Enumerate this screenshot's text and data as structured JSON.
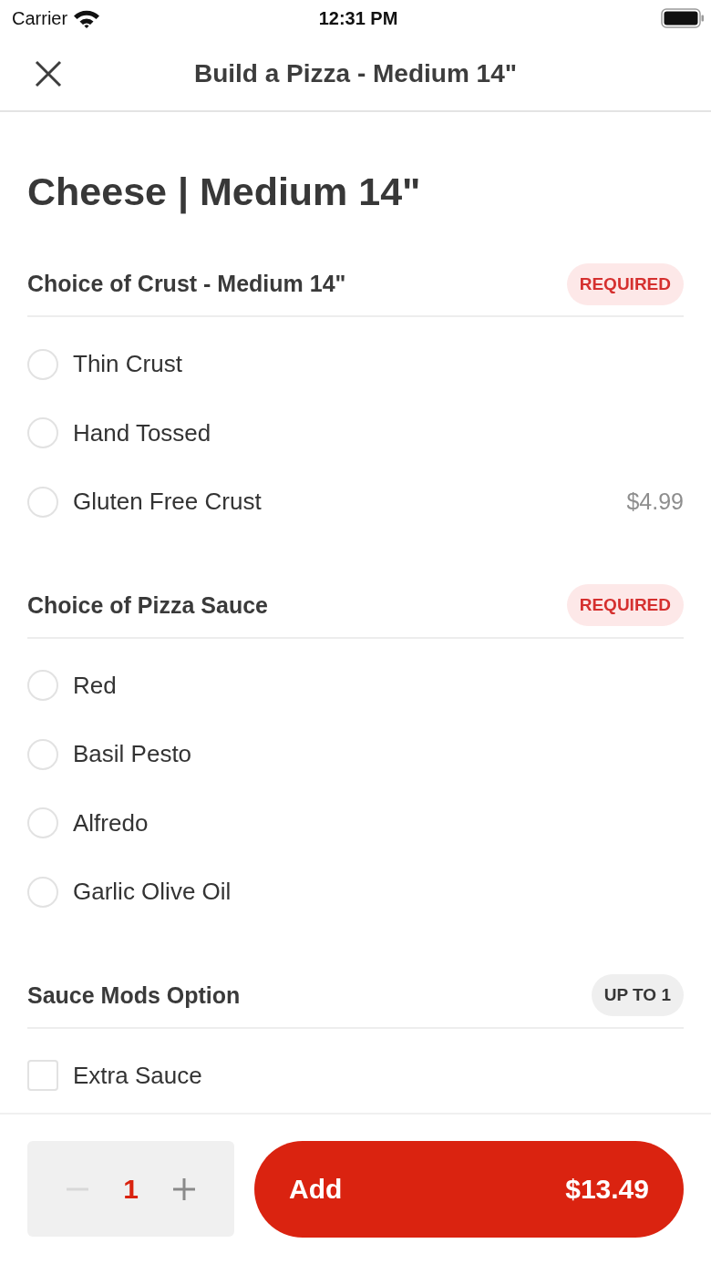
{
  "status_bar": {
    "carrier": "Carrier",
    "time": "12:31 PM"
  },
  "nav_bar": {
    "title": "Build a Pizza - Medium 14\""
  },
  "item_title": "Cheese | Medium 14\"",
  "sections": [
    {
      "title": "Choice of Crust - Medium 14\"",
      "badge": {
        "text": "REQUIRED",
        "kind": "required"
      },
      "options": [
        {
          "kind": "radio",
          "label": "Thin Crust",
          "selected": false
        },
        {
          "kind": "radio",
          "label": "Hand Tossed",
          "selected": false
        },
        {
          "kind": "radio",
          "label": "Gluten Free Crust",
          "price": "$4.99",
          "selected": false
        }
      ]
    },
    {
      "title": "Choice of Pizza Sauce",
      "badge": {
        "text": "REQUIRED",
        "kind": "required"
      },
      "options": [
        {
          "kind": "radio",
          "label": "Red",
          "selected": false
        },
        {
          "kind": "radio",
          "label": "Basil Pesto",
          "selected": false
        },
        {
          "kind": "radio",
          "label": "Alfredo",
          "selected": false
        },
        {
          "kind": "radio",
          "label": "Garlic Olive Oil",
          "selected": false
        }
      ]
    },
    {
      "title": "Sauce Mods Option",
      "badge": {
        "text": "UP TO 1",
        "kind": "limit"
      },
      "options": [
        {
          "kind": "checkbox",
          "label": "Extra Sauce",
          "checked": false
        }
      ]
    }
  ],
  "footer": {
    "stepper": {
      "quantity": "1",
      "decrement": {
        "disabled": true
      },
      "increment": {
        "disabled": false
      }
    },
    "add_button": {
      "label": "Add",
      "price": "$13.49"
    }
  }
}
